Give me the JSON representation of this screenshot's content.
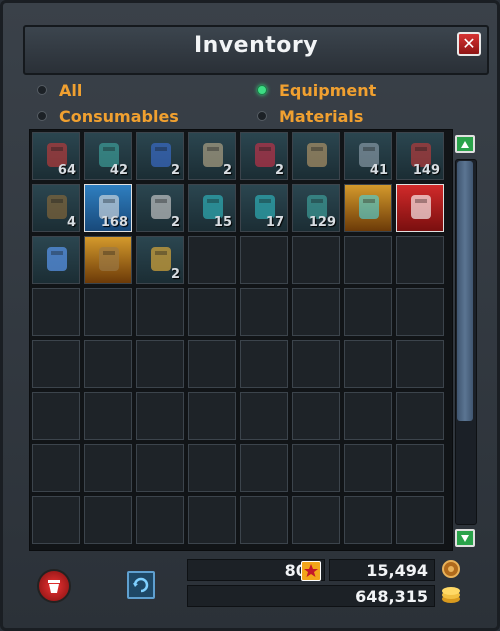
{
  "window": {
    "title": "Inventory",
    "close_label": "✕"
  },
  "filters": [
    {
      "label": "All",
      "selected": false
    },
    {
      "label": "Equipment",
      "selected": true
    },
    {
      "label": "Consumables",
      "selected": false
    },
    {
      "label": "Materials",
      "selected": false
    }
  ],
  "slots": [
    {
      "icon": "red-canister-icon",
      "count": "64"
    },
    {
      "icon": "teal-rifle-icon",
      "count": "42"
    },
    {
      "icon": "blue-crystal-icon",
      "count": "2"
    },
    {
      "icon": "blueprint-card-icon",
      "count": "2"
    },
    {
      "icon": "red-berries-icon",
      "count": "2"
    },
    {
      "icon": "robot-torso-icon",
      "count": ""
    },
    {
      "icon": "metal-cylinder-icon",
      "count": "41"
    },
    {
      "icon": "red-canister-icon",
      "count": "149"
    },
    {
      "icon": "wooden-planks-icon",
      "count": "4"
    },
    {
      "icon": "hammer-icon",
      "count": "168"
    },
    {
      "icon": "paper-sheet-icon",
      "count": "2"
    },
    {
      "icon": "teal-badge-icon",
      "count": "15"
    },
    {
      "icon": "teal-shield-icon",
      "count": "17"
    },
    {
      "icon": "teal-rifle-icon",
      "count": "129"
    },
    {
      "icon": "orange-weapon-icon",
      "count": ""
    },
    {
      "icon": "captain-hat-icon",
      "count": ""
    },
    {
      "icon": "blue-spikes-icon",
      "count": ""
    },
    {
      "icon": "tent-icon",
      "count": ""
    },
    {
      "icon": "gold-nuggets-icon",
      "count": "2"
    }
  ],
  "scroll": {
    "up_icon": "triangle-up-icon",
    "down_icon": "triangle-down-icon"
  },
  "footer": {
    "stars_value": "800",
    "medal_value": "15,494",
    "coins_value": "648,315",
    "colors": {
      "accent": "#f0a030",
      "selected": "#3ddc84",
      "star": "#f2a51a"
    }
  }
}
